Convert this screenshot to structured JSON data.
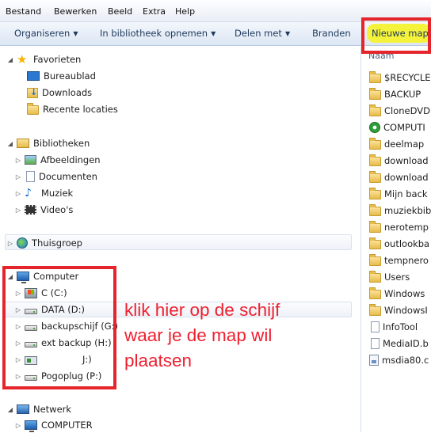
{
  "menu": [
    "Bestand",
    "Bewerken",
    "Beeld",
    "Extra",
    "Help"
  ],
  "toolbar": {
    "organize": "Organiseren",
    "include_library": "In bibliotheek opnemen",
    "share": "Delen met",
    "burn": "Branden",
    "new_folder": "Nieuwe map"
  },
  "nav": {
    "favorites": "Favorieten",
    "fav_items": [
      "Bureaublad",
      "Downloads",
      "Recente locaties"
    ],
    "libraries": "Bibliotheken",
    "lib_items": [
      "Afbeeldingen",
      "Documenten",
      "Muziek",
      "Video's"
    ],
    "homegroup": "Thuisgroep",
    "computer": "Computer",
    "drives": [
      "C (C:)",
      "DATA (D:)",
      "backupschijf (G:)",
      "ext backup (H:)",
      "J:)",
      "Pogoplug (P:)"
    ],
    "network": "Netwerk",
    "network_items": [
      "COMPUTER"
    ]
  },
  "file_list": {
    "column_name": "Naam",
    "items": [
      "$RECYCLE",
      "BACKUP",
      "CloneDVD",
      "COMPUTI",
      "deelmap",
      "download",
      "download",
      "Mijn back",
      "muziekbib",
      "nerotemp",
      "outlookba",
      "tempnero",
      "Users",
      "Windows",
      "WindowsI",
      "InfoTool",
      "MediaID.b",
      "msdia80.c"
    ]
  },
  "annotation": {
    "lines": [
      "klik hier op de schijf",
      "waar je de map wil",
      "plaatsen"
    ],
    "color": "#ee2130"
  },
  "highlight_color": "#f4f23a",
  "box_color": "#e4262c"
}
